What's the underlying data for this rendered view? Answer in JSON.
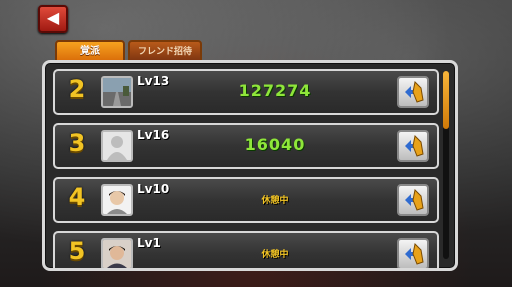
{
  "back_icon": "left-arrow-icon",
  "tabs": [
    {
      "label": "覚派",
      "active": true
    },
    {
      "label": "フレンド招待",
      "active": false
    }
  ],
  "rows": [
    {
      "rank": "2",
      "level": "Lv13",
      "score": "127274",
      "status": "",
      "avatar": "road-photo"
    },
    {
      "rank": "3",
      "level": "Lv16",
      "score": "16040",
      "status": "",
      "avatar": "default-silhouette"
    },
    {
      "rank": "4",
      "level": "Lv10",
      "score": "",
      "status": "休憩中",
      "avatar": "person-photo"
    },
    {
      "rank": "5",
      "level": "Lv1",
      "score": "",
      "status": "休憩中",
      "avatar": "person-photo"
    }
  ],
  "colors": {
    "accent": "#f2c424",
    "score": "#8fe63a",
    "tab_active": "#f7a21f"
  },
  "scroll_position": 0
}
